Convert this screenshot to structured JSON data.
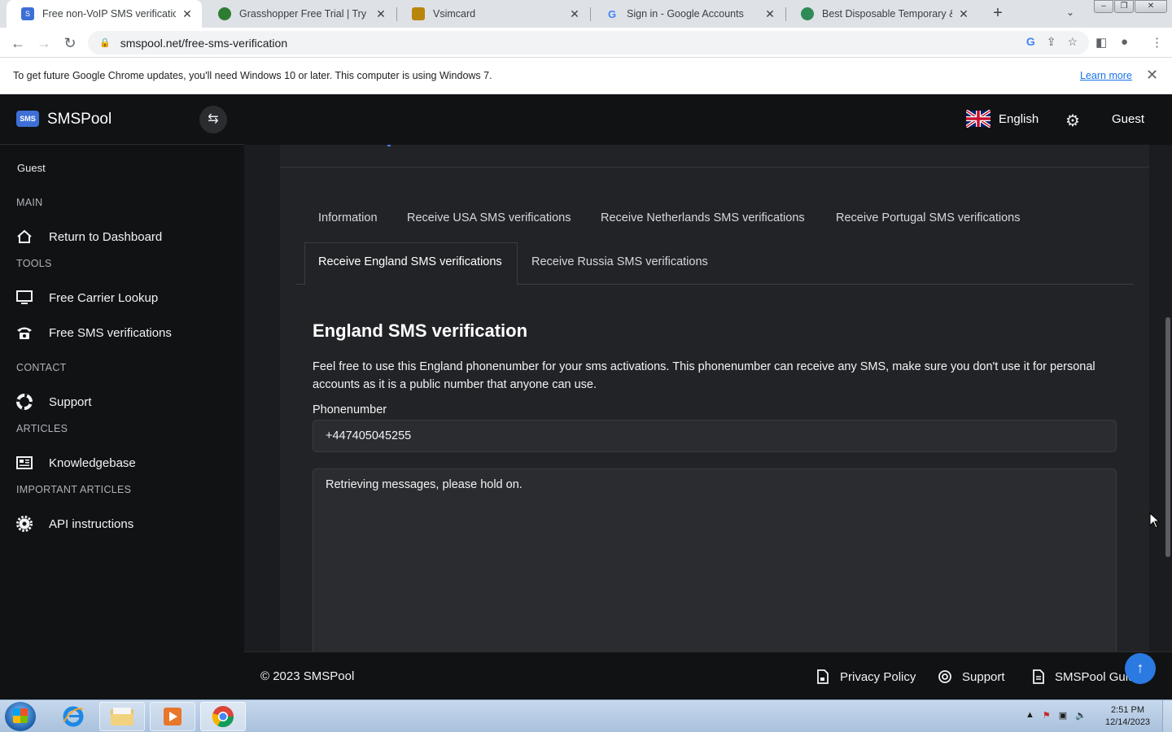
{
  "browser": {
    "tabs": [
      {
        "title": "Free non-VoIP SMS verifications",
        "favicon": "smspool-favicon",
        "active": true
      },
      {
        "title": "Grasshopper Free Trial | Try Free",
        "favicon": "grasshopper-favicon",
        "active": false
      },
      {
        "title": "Vsimcard",
        "favicon": "vsimcard-favicon",
        "active": false
      },
      {
        "title": "Sign in - Google Accounts",
        "favicon": "google-favicon",
        "active": false
      },
      {
        "title": "Best Disposable Temporary & Fa",
        "favicon": "disposable-favicon",
        "active": false
      }
    ],
    "url": "smspool.net/free-sms-verification",
    "infobar": {
      "message": "To get future Google Chrome updates, you'll need Windows 10 or later. This computer is using Windows 7.",
      "link": "Learn more"
    }
  },
  "sidebar": {
    "brand_logo": "SMS",
    "brand_name": "SMSPool",
    "user": "Guest",
    "sections": [
      {
        "label": "MAIN",
        "items": [
          {
            "label": "Return to Dashboard",
            "icon": "home-icon"
          }
        ]
      },
      {
        "label": "TOOLS",
        "items": [
          {
            "label": "Free Carrier Lookup",
            "icon": "monitor-icon"
          },
          {
            "label": "Free SMS verifications",
            "icon": "phone-icon"
          }
        ]
      },
      {
        "label": "CONTACT",
        "items": [
          {
            "label": "Support",
            "icon": "lifebuoy-icon"
          }
        ]
      },
      {
        "label": "ARTICLES",
        "items": [
          {
            "label": "Knowledgebase",
            "icon": "newspaper-icon"
          }
        ]
      },
      {
        "label": "IMPORTANT ARTICLES",
        "items": [
          {
            "label": "API instructions",
            "icon": "cog-icon"
          }
        ]
      }
    ]
  },
  "header": {
    "language": "English",
    "user": "Guest"
  },
  "main": {
    "tabs": [
      "Information",
      "Receive USA SMS verifications",
      "Receive Netherlands SMS verifications",
      "Receive Portugal SMS verifications",
      "Receive England SMS verifications",
      "Receive Russia SMS verifications"
    ],
    "active_tab": "Receive England SMS verifications",
    "title": "England SMS verification",
    "description": "Feel free to use this England phonenumber for your sms activations. This phonenumber can receive any SMS, make sure you don't use it for personal accounts as it is a public number that anyone can use.",
    "phone_label": "Phonenumber",
    "phone_value": "+447405045255",
    "messages_status": "Retrieving messages, please hold on."
  },
  "footer": {
    "copyright": "© 2023 SMSPool",
    "links": [
      "Privacy Policy",
      "Support",
      "SMSPool Guide"
    ]
  },
  "taskbar": {
    "time": "2:51 PM",
    "date": "12/14/2023"
  },
  "colors": {
    "accent": "#2a7ae2",
    "sidebar_bg": "#111214",
    "content_bg": "#1b1c1f"
  }
}
